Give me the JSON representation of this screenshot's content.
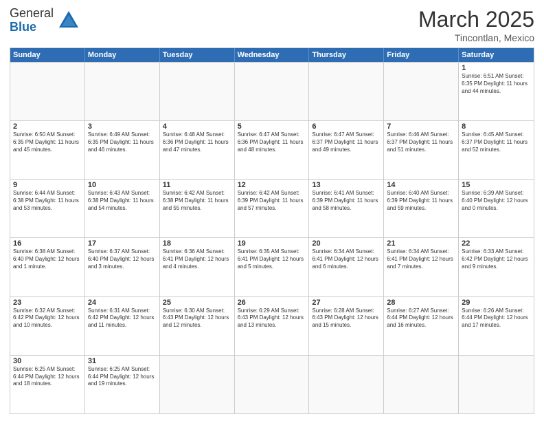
{
  "header": {
    "logo_line1": "General",
    "logo_line2": "Blue",
    "month_title": "March 2025",
    "location": "Tincontlan, Mexico"
  },
  "days_of_week": [
    "Sunday",
    "Monday",
    "Tuesday",
    "Wednesday",
    "Thursday",
    "Friday",
    "Saturday"
  ],
  "weeks": [
    [
      {
        "day": "",
        "info": ""
      },
      {
        "day": "",
        "info": ""
      },
      {
        "day": "",
        "info": ""
      },
      {
        "day": "",
        "info": ""
      },
      {
        "day": "",
        "info": ""
      },
      {
        "day": "",
        "info": ""
      },
      {
        "day": "1",
        "info": "Sunrise: 6:51 AM\nSunset: 6:35 PM\nDaylight: 11 hours and 44 minutes."
      }
    ],
    [
      {
        "day": "2",
        "info": "Sunrise: 6:50 AM\nSunset: 6:35 PM\nDaylight: 11 hours and 45 minutes."
      },
      {
        "day": "3",
        "info": "Sunrise: 6:49 AM\nSunset: 6:35 PM\nDaylight: 11 hours and 46 minutes."
      },
      {
        "day": "4",
        "info": "Sunrise: 6:48 AM\nSunset: 6:36 PM\nDaylight: 11 hours and 47 minutes."
      },
      {
        "day": "5",
        "info": "Sunrise: 6:47 AM\nSunset: 6:36 PM\nDaylight: 11 hours and 48 minutes."
      },
      {
        "day": "6",
        "info": "Sunrise: 6:47 AM\nSunset: 6:37 PM\nDaylight: 11 hours and 49 minutes."
      },
      {
        "day": "7",
        "info": "Sunrise: 6:46 AM\nSunset: 6:37 PM\nDaylight: 11 hours and 51 minutes."
      },
      {
        "day": "8",
        "info": "Sunrise: 6:45 AM\nSunset: 6:37 PM\nDaylight: 11 hours and 52 minutes."
      }
    ],
    [
      {
        "day": "9",
        "info": "Sunrise: 6:44 AM\nSunset: 6:38 PM\nDaylight: 11 hours and 53 minutes."
      },
      {
        "day": "10",
        "info": "Sunrise: 6:43 AM\nSunset: 6:38 PM\nDaylight: 11 hours and 54 minutes."
      },
      {
        "day": "11",
        "info": "Sunrise: 6:42 AM\nSunset: 6:38 PM\nDaylight: 11 hours and 55 minutes."
      },
      {
        "day": "12",
        "info": "Sunrise: 6:42 AM\nSunset: 6:39 PM\nDaylight: 11 hours and 57 minutes."
      },
      {
        "day": "13",
        "info": "Sunrise: 6:41 AM\nSunset: 6:39 PM\nDaylight: 11 hours and 58 minutes."
      },
      {
        "day": "14",
        "info": "Sunrise: 6:40 AM\nSunset: 6:39 PM\nDaylight: 11 hours and 59 minutes."
      },
      {
        "day": "15",
        "info": "Sunrise: 6:39 AM\nSunset: 6:40 PM\nDaylight: 12 hours and 0 minutes."
      }
    ],
    [
      {
        "day": "16",
        "info": "Sunrise: 6:38 AM\nSunset: 6:40 PM\nDaylight: 12 hours and 1 minute."
      },
      {
        "day": "17",
        "info": "Sunrise: 6:37 AM\nSunset: 6:40 PM\nDaylight: 12 hours and 3 minutes."
      },
      {
        "day": "18",
        "info": "Sunrise: 6:36 AM\nSunset: 6:41 PM\nDaylight: 12 hours and 4 minutes."
      },
      {
        "day": "19",
        "info": "Sunrise: 6:35 AM\nSunset: 6:41 PM\nDaylight: 12 hours and 5 minutes."
      },
      {
        "day": "20",
        "info": "Sunrise: 6:34 AM\nSunset: 6:41 PM\nDaylight: 12 hours and 6 minutes."
      },
      {
        "day": "21",
        "info": "Sunrise: 6:34 AM\nSunset: 6:41 PM\nDaylight: 12 hours and 7 minutes."
      },
      {
        "day": "22",
        "info": "Sunrise: 6:33 AM\nSunset: 6:42 PM\nDaylight: 12 hours and 9 minutes."
      }
    ],
    [
      {
        "day": "23",
        "info": "Sunrise: 6:32 AM\nSunset: 6:42 PM\nDaylight: 12 hours and 10 minutes."
      },
      {
        "day": "24",
        "info": "Sunrise: 6:31 AM\nSunset: 6:42 PM\nDaylight: 12 hours and 11 minutes."
      },
      {
        "day": "25",
        "info": "Sunrise: 6:30 AM\nSunset: 6:43 PM\nDaylight: 12 hours and 12 minutes."
      },
      {
        "day": "26",
        "info": "Sunrise: 6:29 AM\nSunset: 6:43 PM\nDaylight: 12 hours and 13 minutes."
      },
      {
        "day": "27",
        "info": "Sunrise: 6:28 AM\nSunset: 6:43 PM\nDaylight: 12 hours and 15 minutes."
      },
      {
        "day": "28",
        "info": "Sunrise: 6:27 AM\nSunset: 6:44 PM\nDaylight: 12 hours and 16 minutes."
      },
      {
        "day": "29",
        "info": "Sunrise: 6:26 AM\nSunset: 6:44 PM\nDaylight: 12 hours and 17 minutes."
      }
    ],
    [
      {
        "day": "30",
        "info": "Sunrise: 6:25 AM\nSunset: 6:44 PM\nDaylight: 12 hours and 18 minutes."
      },
      {
        "day": "31",
        "info": "Sunrise: 6:25 AM\nSunset: 6:44 PM\nDaylight: 12 hours and 19 minutes."
      },
      {
        "day": "",
        "info": ""
      },
      {
        "day": "",
        "info": ""
      },
      {
        "day": "",
        "info": ""
      },
      {
        "day": "",
        "info": ""
      },
      {
        "day": "",
        "info": ""
      }
    ]
  ]
}
